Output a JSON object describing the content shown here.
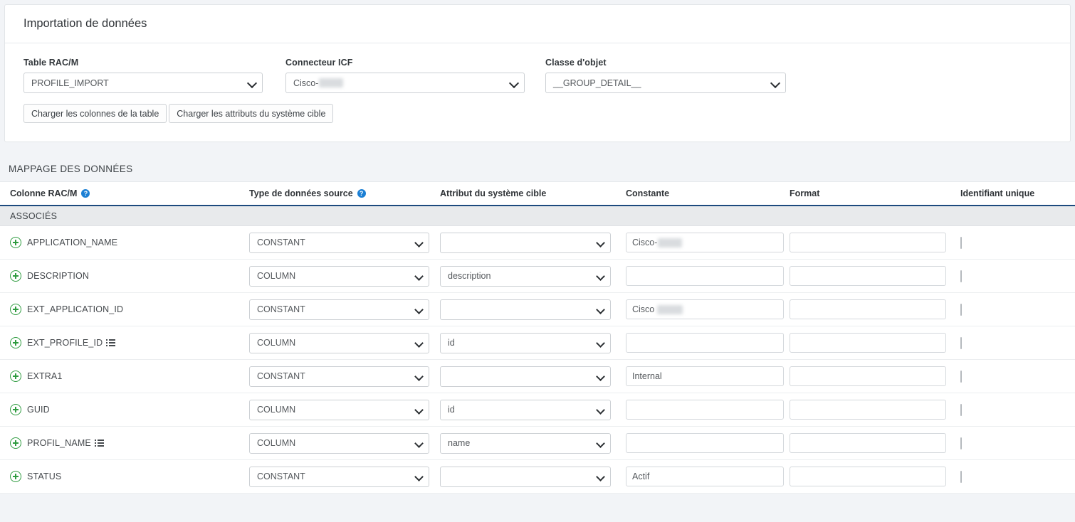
{
  "card": {
    "title": "Importation de données",
    "fields": [
      {
        "label": "Table RAC/M",
        "value": "PROFILE_IMPORT",
        "name": "table-racm"
      },
      {
        "label": "Connecteur ICF",
        "value": "Cisco-",
        "redacted": true,
        "name": "connecteur-icf"
      },
      {
        "label": "Classe d'objet",
        "value": "__GROUP_DETAIL__",
        "name": "classe-objet"
      }
    ],
    "buttons": [
      {
        "label": "Charger les colonnes de la table",
        "name": "load-table-columns-button"
      },
      {
        "label": "Charger les attributs du système cible",
        "name": "load-target-attributes-button"
      }
    ]
  },
  "mapping": {
    "section_title": "MAPPAGE DES DONNÉES",
    "columns": [
      {
        "label": "Colonne RAC/M",
        "help": true
      },
      {
        "label": "Type de données source",
        "help": true
      },
      {
        "label": "Attribut du système cible",
        "help": false
      },
      {
        "label": "Constante",
        "help": false
      },
      {
        "label": "Format",
        "help": false
      },
      {
        "label": "Identifiant unique",
        "help": false
      }
    ],
    "help_glyph": "?",
    "group_label": "ASSOCIÉS",
    "rows": [
      {
        "name": "APPLICATION_NAME",
        "has_list_icon": false,
        "source_type": "CONSTANT",
        "target_attribute": "",
        "constant": "Cisco-",
        "constant_redacted": true,
        "constant_redact_space": false,
        "format": "",
        "unique_id": false
      },
      {
        "name": "DESCRIPTION",
        "has_list_icon": false,
        "source_type": "COLUMN",
        "target_attribute": "description",
        "constant": "",
        "constant_redacted": false,
        "constant_redact_space": false,
        "format": "",
        "unique_id": false
      },
      {
        "name": "EXT_APPLICATION_ID",
        "has_list_icon": false,
        "source_type": "CONSTANT",
        "target_attribute": "",
        "constant": "Cisco",
        "constant_redacted": true,
        "constant_redact_space": true,
        "format": "",
        "unique_id": false
      },
      {
        "name": "EXT_PROFILE_ID",
        "has_list_icon": true,
        "source_type": "COLUMN",
        "target_attribute": "id",
        "constant": "",
        "constant_redacted": false,
        "constant_redact_space": false,
        "format": "",
        "unique_id": false
      },
      {
        "name": "EXTRA1",
        "has_list_icon": false,
        "source_type": "CONSTANT",
        "target_attribute": "",
        "constant": "Internal",
        "constant_redacted": false,
        "constant_redact_space": false,
        "format": "",
        "unique_id": false
      },
      {
        "name": "GUID",
        "has_list_icon": false,
        "source_type": "COLUMN",
        "target_attribute": "id",
        "constant": "",
        "constant_redacted": false,
        "constant_redact_space": false,
        "format": "",
        "unique_id": false
      },
      {
        "name": "PROFIL_NAME",
        "has_list_icon": true,
        "source_type": "COLUMN",
        "target_attribute": "name",
        "constant": "",
        "constant_redacted": false,
        "constant_redact_space": false,
        "format": "",
        "unique_id": false
      },
      {
        "name": "STATUS",
        "has_list_icon": false,
        "source_type": "CONSTANT",
        "target_attribute": "",
        "constant": "Actif",
        "constant_redacted": false,
        "constant_redact_space": false,
        "format": "",
        "unique_id": false
      }
    ]
  },
  "colors": {
    "accent_blue": "#1c4a7e",
    "help_blue": "#1b7fd4",
    "plus_green": "#2e9b3f",
    "band_gray": "#e8eaec",
    "page_bg": "#f2f4f7"
  }
}
